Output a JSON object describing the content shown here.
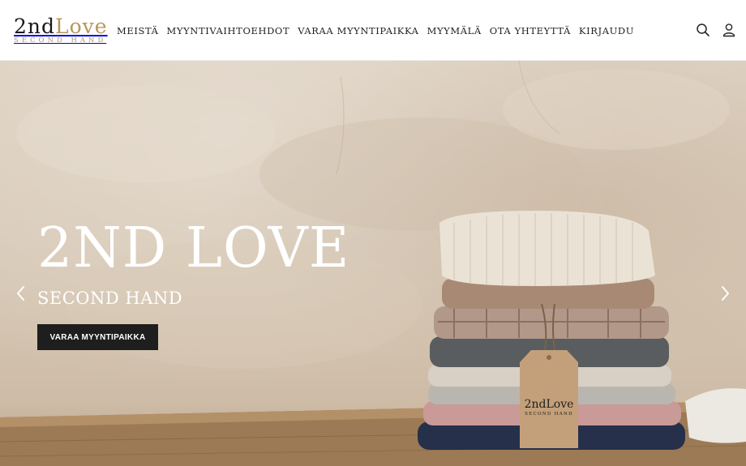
{
  "header": {
    "logo": {
      "main_prefix": "2nd",
      "main_suffix": "Love",
      "tagline": "SECOND HAND"
    },
    "nav": [
      {
        "label": "MEISTÄ"
      },
      {
        "label": "MYYNTIVAIHTOEHDOT"
      },
      {
        "label": "VARAA MYYNTIPAIKKA"
      },
      {
        "label": "MYYMÄLÄ"
      },
      {
        "label": "OTA YHTEYTTÄ"
      },
      {
        "label": "KIRJAUDU"
      }
    ],
    "icons": [
      "search-icon",
      "account-icon"
    ]
  },
  "hero": {
    "title": "2ND LOVE",
    "subtitle": "SECOND HAND",
    "cta_label": "VARAA MYYNTIPAIKKA",
    "tag_text_main": "2ndLove",
    "tag_text_sub": "SECOND HAND"
  },
  "colors": {
    "brand_gold": "#b8955a",
    "cta_background": "#1e1e1e",
    "hero_wall": "#d6c7b4"
  }
}
